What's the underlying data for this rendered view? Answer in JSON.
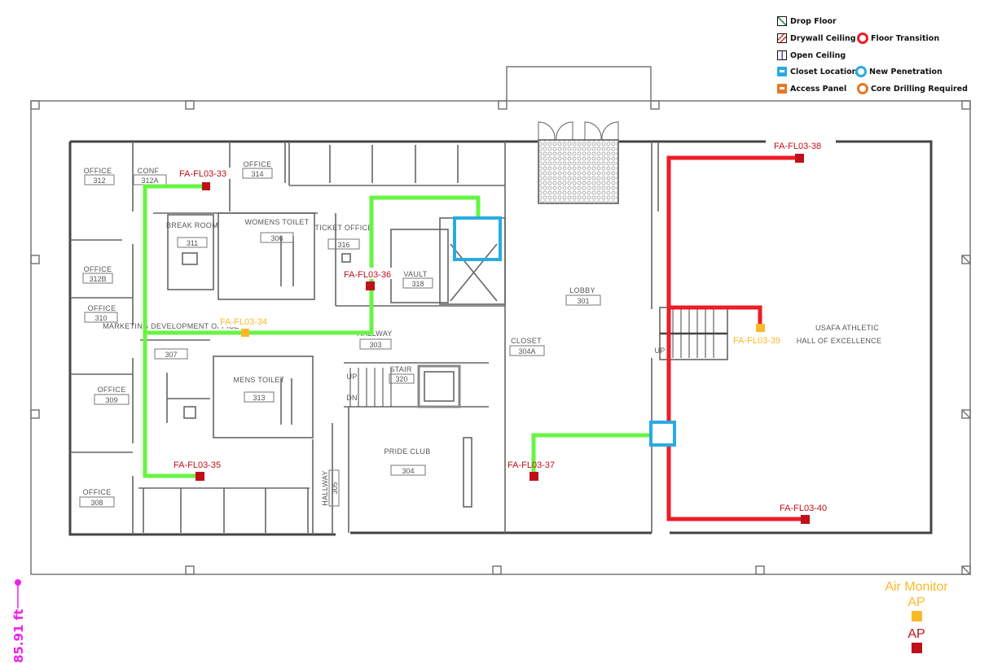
{
  "legend": {
    "items": [
      {
        "label": "Drop Floor",
        "icon": "drop-floor-hatch-icon",
        "color": "#2e9e4f"
      },
      {
        "label": "Drywall Ceiling",
        "icon": "drywall-ceiling-hatch-icon",
        "color": "#d8232a"
      },
      {
        "label": "Open Ceiling",
        "icon": "open-ceiling-icon",
        "color": "#6b3fa0"
      },
      {
        "label": "Closet Location",
        "icon": "closet-location-icon",
        "color": "#29abe2"
      },
      {
        "label": "Access Panel",
        "icon": "access-panel-icon",
        "color": "#e87722"
      },
      {
        "label": "Floor Transition",
        "icon": "floor-transition-ring-icon",
        "color": "#ee1c25"
      },
      {
        "label": "New Penetration",
        "icon": "new-penetration-ring-icon",
        "color": "#29abe2"
      },
      {
        "label": "Core Drilling Required",
        "icon": "core-drilling-ring-icon",
        "color": "#e87722"
      }
    ]
  },
  "ap_legend": {
    "air_monitor_line1": "Air Monitor",
    "air_monitor_line2": "AP",
    "air_monitor_color": "#fbb829",
    "ap_label": "AP",
    "ap_color": "#c0101a"
  },
  "scale": {
    "label": "85.91 ft",
    "color": "#ee22ee"
  },
  "rooms": [
    {
      "name": "OFFICE",
      "number": "312"
    },
    {
      "name": "CONF",
      "number": "312A"
    },
    {
      "name": "OFFICE",
      "number": "314"
    },
    {
      "name": "OFFICE",
      "number": "312B"
    },
    {
      "name": "BREAK ROOM",
      "number": "311"
    },
    {
      "name": "WOMENS TOILET",
      "number": "306"
    },
    {
      "name": "TICKET OFFICE",
      "number": "316"
    },
    {
      "name": "VAULT",
      "number": "318"
    },
    {
      "name": "OFFICE",
      "number": "310"
    },
    {
      "name": "MARKETING DEVELOPMENT OFFICE",
      "number": "307"
    },
    {
      "name": "HALLWAY",
      "number": "303"
    },
    {
      "name": "OFFICE",
      "number": "309"
    },
    {
      "name": "MENS TOILET",
      "number": "313"
    },
    {
      "name": "STAIR",
      "number": "320"
    },
    {
      "name": "OFFICE",
      "number": "308"
    },
    {
      "name": "HALLWAY",
      "number": "305"
    },
    {
      "name": "PRIDE CLUB",
      "number": "304"
    },
    {
      "name": "LOBBY",
      "number": "301"
    },
    {
      "name": "CLOSET",
      "number": "304A"
    },
    {
      "name": "USAFA ATHLETIC HALL OF EXCELLENCE",
      "number": ""
    }
  ],
  "stair_labels": {
    "up": "UP",
    "dn": "DN"
  },
  "access_points": [
    {
      "id": "FA-FL03-33",
      "type": "AP"
    },
    {
      "id": "FA-FL03-34",
      "type": "Air Monitor AP"
    },
    {
      "id": "FA-FL03-35",
      "type": "AP"
    },
    {
      "id": "FA-FL03-36",
      "type": "AP"
    },
    {
      "id": "FA-FL03-37",
      "type": "AP"
    },
    {
      "id": "FA-FL03-38",
      "type": "AP"
    },
    {
      "id": "FA-FL03-39",
      "type": "Air Monitor AP"
    },
    {
      "id": "FA-FL03-40",
      "type": "AP"
    }
  ],
  "cable_colors": {
    "green_run": "#66f542",
    "red_run": "#ee1c25",
    "closet": "#29abe2"
  }
}
